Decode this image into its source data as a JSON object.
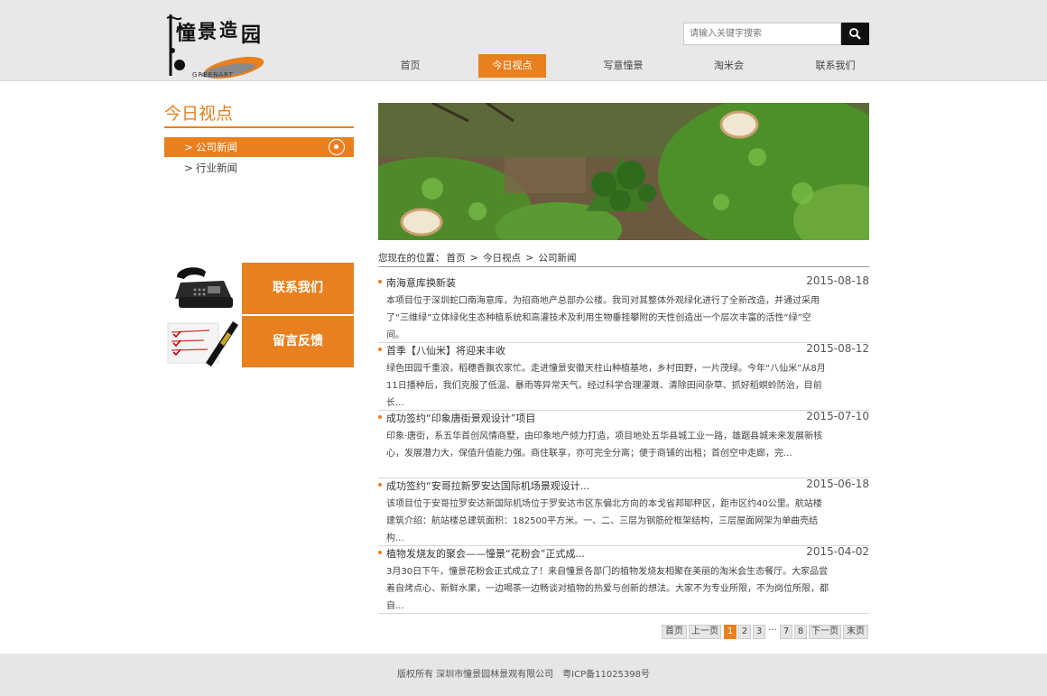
{
  "brand": {
    "logo_sub": "GREENART",
    "accent": "#e8801f"
  },
  "search": {
    "placeholder": "请输入关键字搜索"
  },
  "nav": [
    {
      "label": "首页"
    },
    {
      "label": "今日视点",
      "active": true
    },
    {
      "label": "写意憧景"
    },
    {
      "label": "淘米会"
    },
    {
      "label": "联系我们"
    }
  ],
  "sidebar": {
    "title": "今日视点",
    "items": [
      {
        "label": "公司新闻",
        "active": true
      },
      {
        "label": "行业新闻"
      }
    ],
    "contact_label": "联系我们",
    "feedback_label": "留言反馈"
  },
  "breadcrumb": {
    "prefix": "您现在的位置：",
    "items": [
      "首页",
      "今日视点",
      "公司新闻"
    ]
  },
  "news": [
    {
      "title": "南海意库换新装",
      "date": "2015-08-18",
      "desc": "本项目位于深圳蛇口南海意库，为招商地产总部办公楼。我司对其整体外观绿化进行了全新改造，并通过采用了“三维绿”立体绿化生态种植系统和高灌技术及利用生物垂挂攀附的天性创造出一个层次丰富的活性“绿”空间。"
    },
    {
      "title": "首季【八仙米】将迎来丰收",
      "date": "2015-08-12",
      "desc": "绿色田园千重浪，稻穗香飘农家忙。走进憧景安徽天柱山种植基地，乡村田野，一片茂绿。今年“八仙米”从8月11日播种后，我们克服了低温、暴雨等异常天气。经过科学合理灌溉、清除田间杂草、抓好稻螟蛉防治，目前长..."
    },
    {
      "title": "成功签约“印象唐街景观设计”项目",
      "date": "2015-07-10",
      "desc": "印象·唐街，系五华首创风情商墅，由印象地产倾力打造，项目地处五华县城工业一路，雄踞县城未来发展新核心，发展潜力大，保值升值能力强。商住联享，亦可完全分离；便于商铺的出租；首创空中走廊，完..."
    },
    {
      "title": "成功签约“安哥拉新罗安达国际机场景观设计...",
      "date": "2015-06-18",
      "desc": "该项目位于安哥拉罗安达新国际机场位于罗安达市区东偏北方向的本戈省邦耶秤区，距市区约40公里。航站楼建筑介绍：航站楼总建筑面积：182500平方米。一、二、三层为钢筋砼框架结构，三层屋面网架为单曲壳结构..."
    },
    {
      "title": "植物发烧友的聚会——憧景“花粉会”正式成...",
      "date": "2015-04-02",
      "desc": "3月30日下午，憧景花粉会正式成立了！来自憧景各部门的植物发烧友相聚在美丽的淘米会生态餐厅。大家品尝着自烤点心、新鲜水果，一边喝茶一边畅谈对植物的热爱与创新的想法。大家不为专业所限，不为岗位所限，都自..."
    }
  ],
  "pager": {
    "first": "首页",
    "prev": "上一页",
    "pages": [
      "1",
      "2",
      "3"
    ],
    "dots": "···",
    "pages2": [
      "7",
      "8"
    ],
    "next": "下一页",
    "last": "末页"
  },
  "footer": {
    "text": "版权所有 深圳市憧景园林景观有限公司　粤ICP备11025398号"
  }
}
